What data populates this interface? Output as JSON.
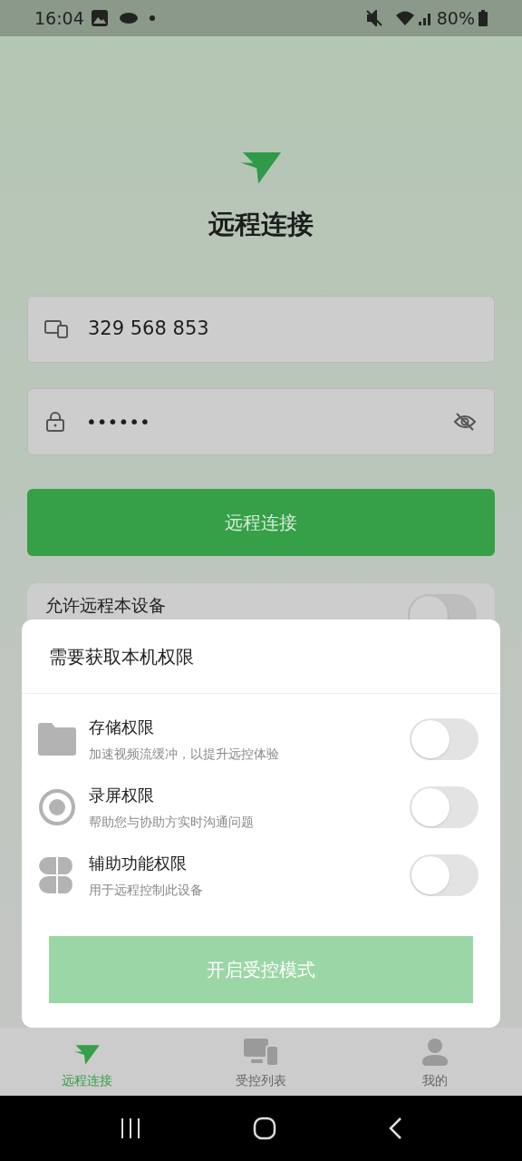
{
  "status_bar": {
    "time": "16:04",
    "battery": "80%"
  },
  "title": "远程连接",
  "device_field": {
    "value": "329 568 853"
  },
  "password_field": {
    "value": "••••••"
  },
  "connect_button": "远程连接",
  "allow_row": {
    "label": "允许远程本设备",
    "on": false
  },
  "sheet": {
    "title": "需要获取本机权限",
    "permissions": [
      {
        "kind": "folder",
        "title": "存储权限",
        "desc": "加速视频流缓冲，以提升远控体验",
        "on": false
      },
      {
        "kind": "record",
        "title": "录屏权限",
        "desc": "帮助您与协助方实时沟通问题",
        "on": false
      },
      {
        "kind": "grid",
        "title": "辅助功能权限",
        "desc": "用于远程控制此设备",
        "on": false
      }
    ],
    "button": "开启受控模式"
  },
  "tabs": [
    {
      "kind": "send",
      "label": "远程连接",
      "selected": true
    },
    {
      "kind": "devices",
      "label": "受控列表",
      "selected": false
    },
    {
      "kind": "person",
      "label": "我的",
      "selected": false
    }
  ]
}
